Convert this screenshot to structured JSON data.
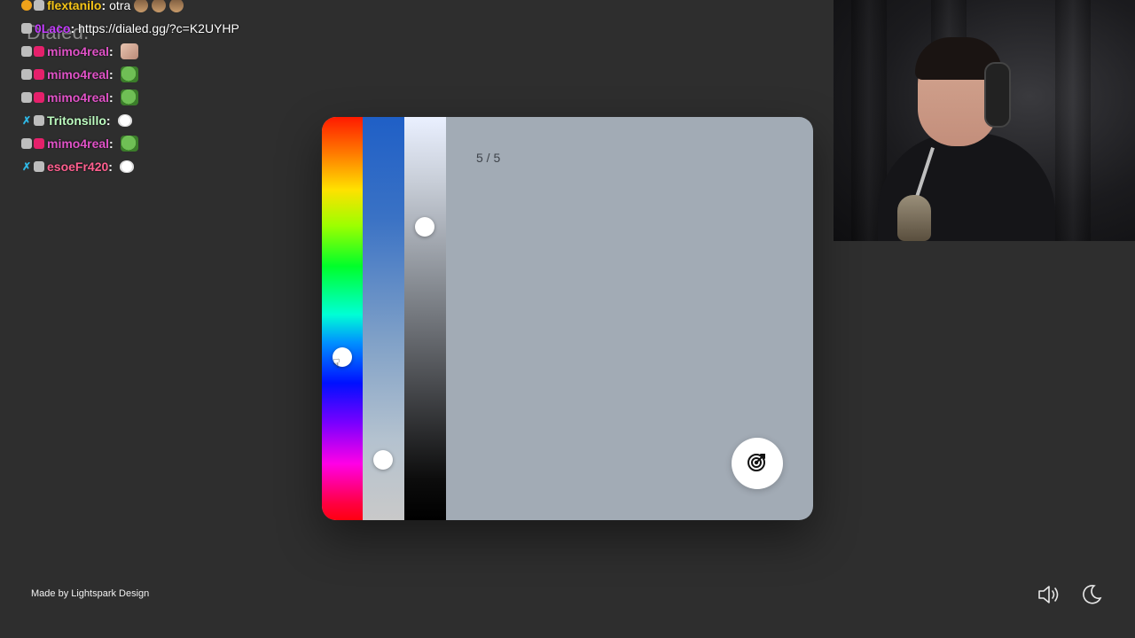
{
  "brand": {
    "title": "Dialed."
  },
  "chat": [
    {
      "username": "flextanilo",
      "color": "#f5c518",
      "badges": [
        "gold",
        "gray"
      ],
      "message": "otra",
      "emotes": [
        "face",
        "face",
        "face"
      ]
    },
    {
      "username": "0Laco",
      "color": "#c43cff",
      "badges": [
        "gray"
      ],
      "message": "https://dialed.gg/?c=K2UYHP",
      "emotes": []
    },
    {
      "username": "mimo4real",
      "color": "#e052c7",
      "badges": [
        "gray",
        "pink"
      ],
      "message": "",
      "emotes": [
        "person"
      ]
    },
    {
      "username": "mimo4real",
      "color": "#e052c7",
      "badges": [
        "gray",
        "pink"
      ],
      "message": "",
      "emotes": [
        "pepe"
      ]
    },
    {
      "username": "mimo4real",
      "color": "#e052c7",
      "badges": [
        "gray",
        "pink"
      ],
      "message": "",
      "emotes": [
        "pepe"
      ]
    },
    {
      "username": "Tritonsillo",
      "color": "#bdfcc0",
      "badges": [
        "cyan",
        "gray"
      ],
      "message": "",
      "emotes": [
        "cat"
      ]
    },
    {
      "username": "mimo4real",
      "color": "#e052c7",
      "badges": [
        "gray",
        "pink"
      ],
      "message": "",
      "emotes": [
        "pepe"
      ]
    },
    {
      "username": "esoeFr420",
      "color": "#ff5f8f",
      "badges": [
        "cyan",
        "gray"
      ],
      "message": "",
      "emotes": [
        "cat"
      ]
    }
  ],
  "picker": {
    "counter": "5 / 5",
    "selected_color": "#a2abb5",
    "hue_level": 0.59,
    "saturation_level": 0.85,
    "lightness_level": 0.27,
    "random_button_icon": "dice-target-icon"
  },
  "footer": {
    "credit": "Made by Lightspark Design",
    "sound_icon": "speaker-icon",
    "theme_icon": "moon-icon"
  }
}
